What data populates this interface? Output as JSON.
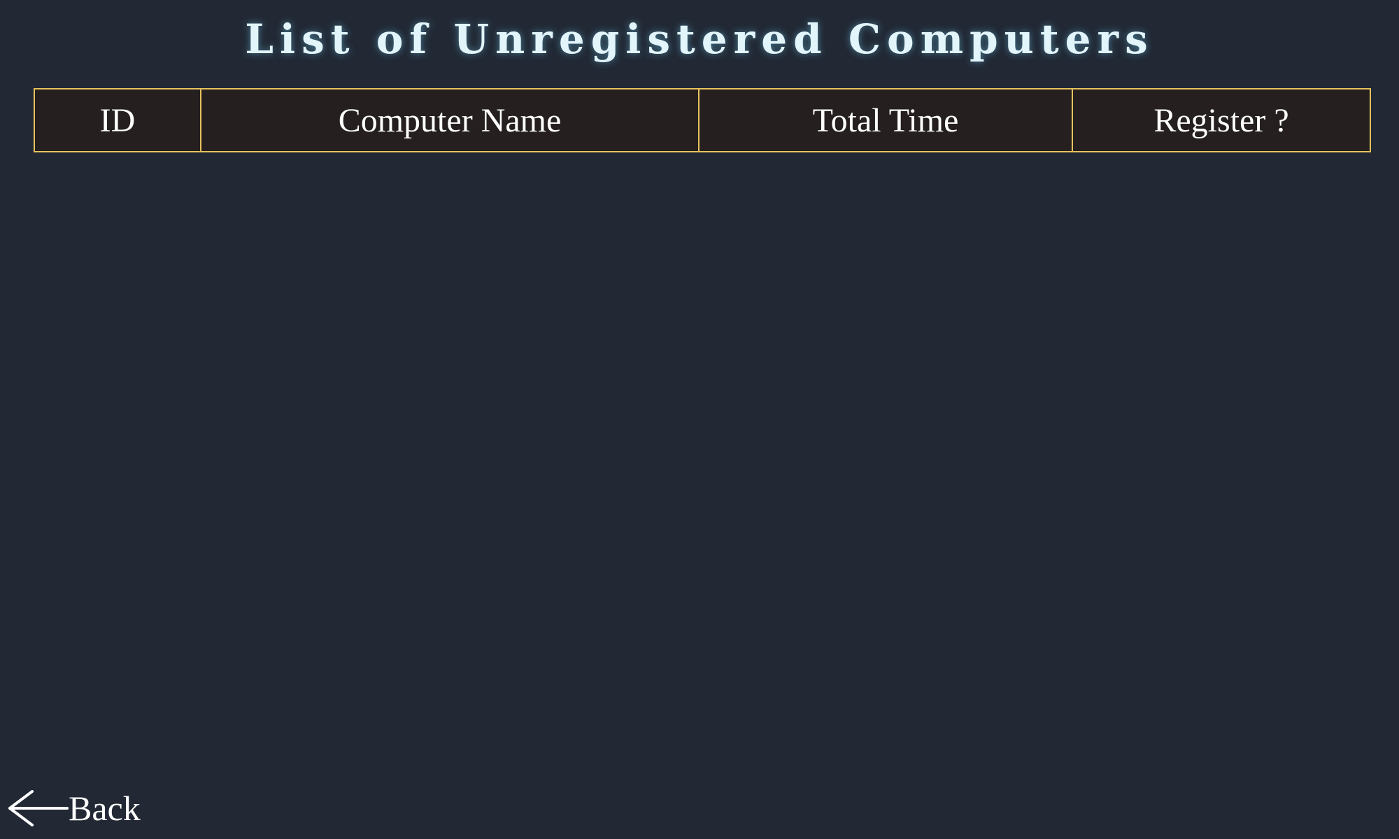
{
  "page": {
    "title": "List of Unregistered Computers"
  },
  "table": {
    "columns": [
      {
        "label": "ID"
      },
      {
        "label": "Computer Name"
      },
      {
        "label": "Total Time"
      },
      {
        "label": "Register ?"
      }
    ],
    "rows": []
  },
  "nav": {
    "back_label": "Back",
    "back_icon": "left-arrow-icon"
  },
  "colors": {
    "background": "#222935",
    "title_text": "#e2f5fb",
    "header_background": "#25201f",
    "header_border": "#e7c25d",
    "header_text": "#ffffff"
  }
}
